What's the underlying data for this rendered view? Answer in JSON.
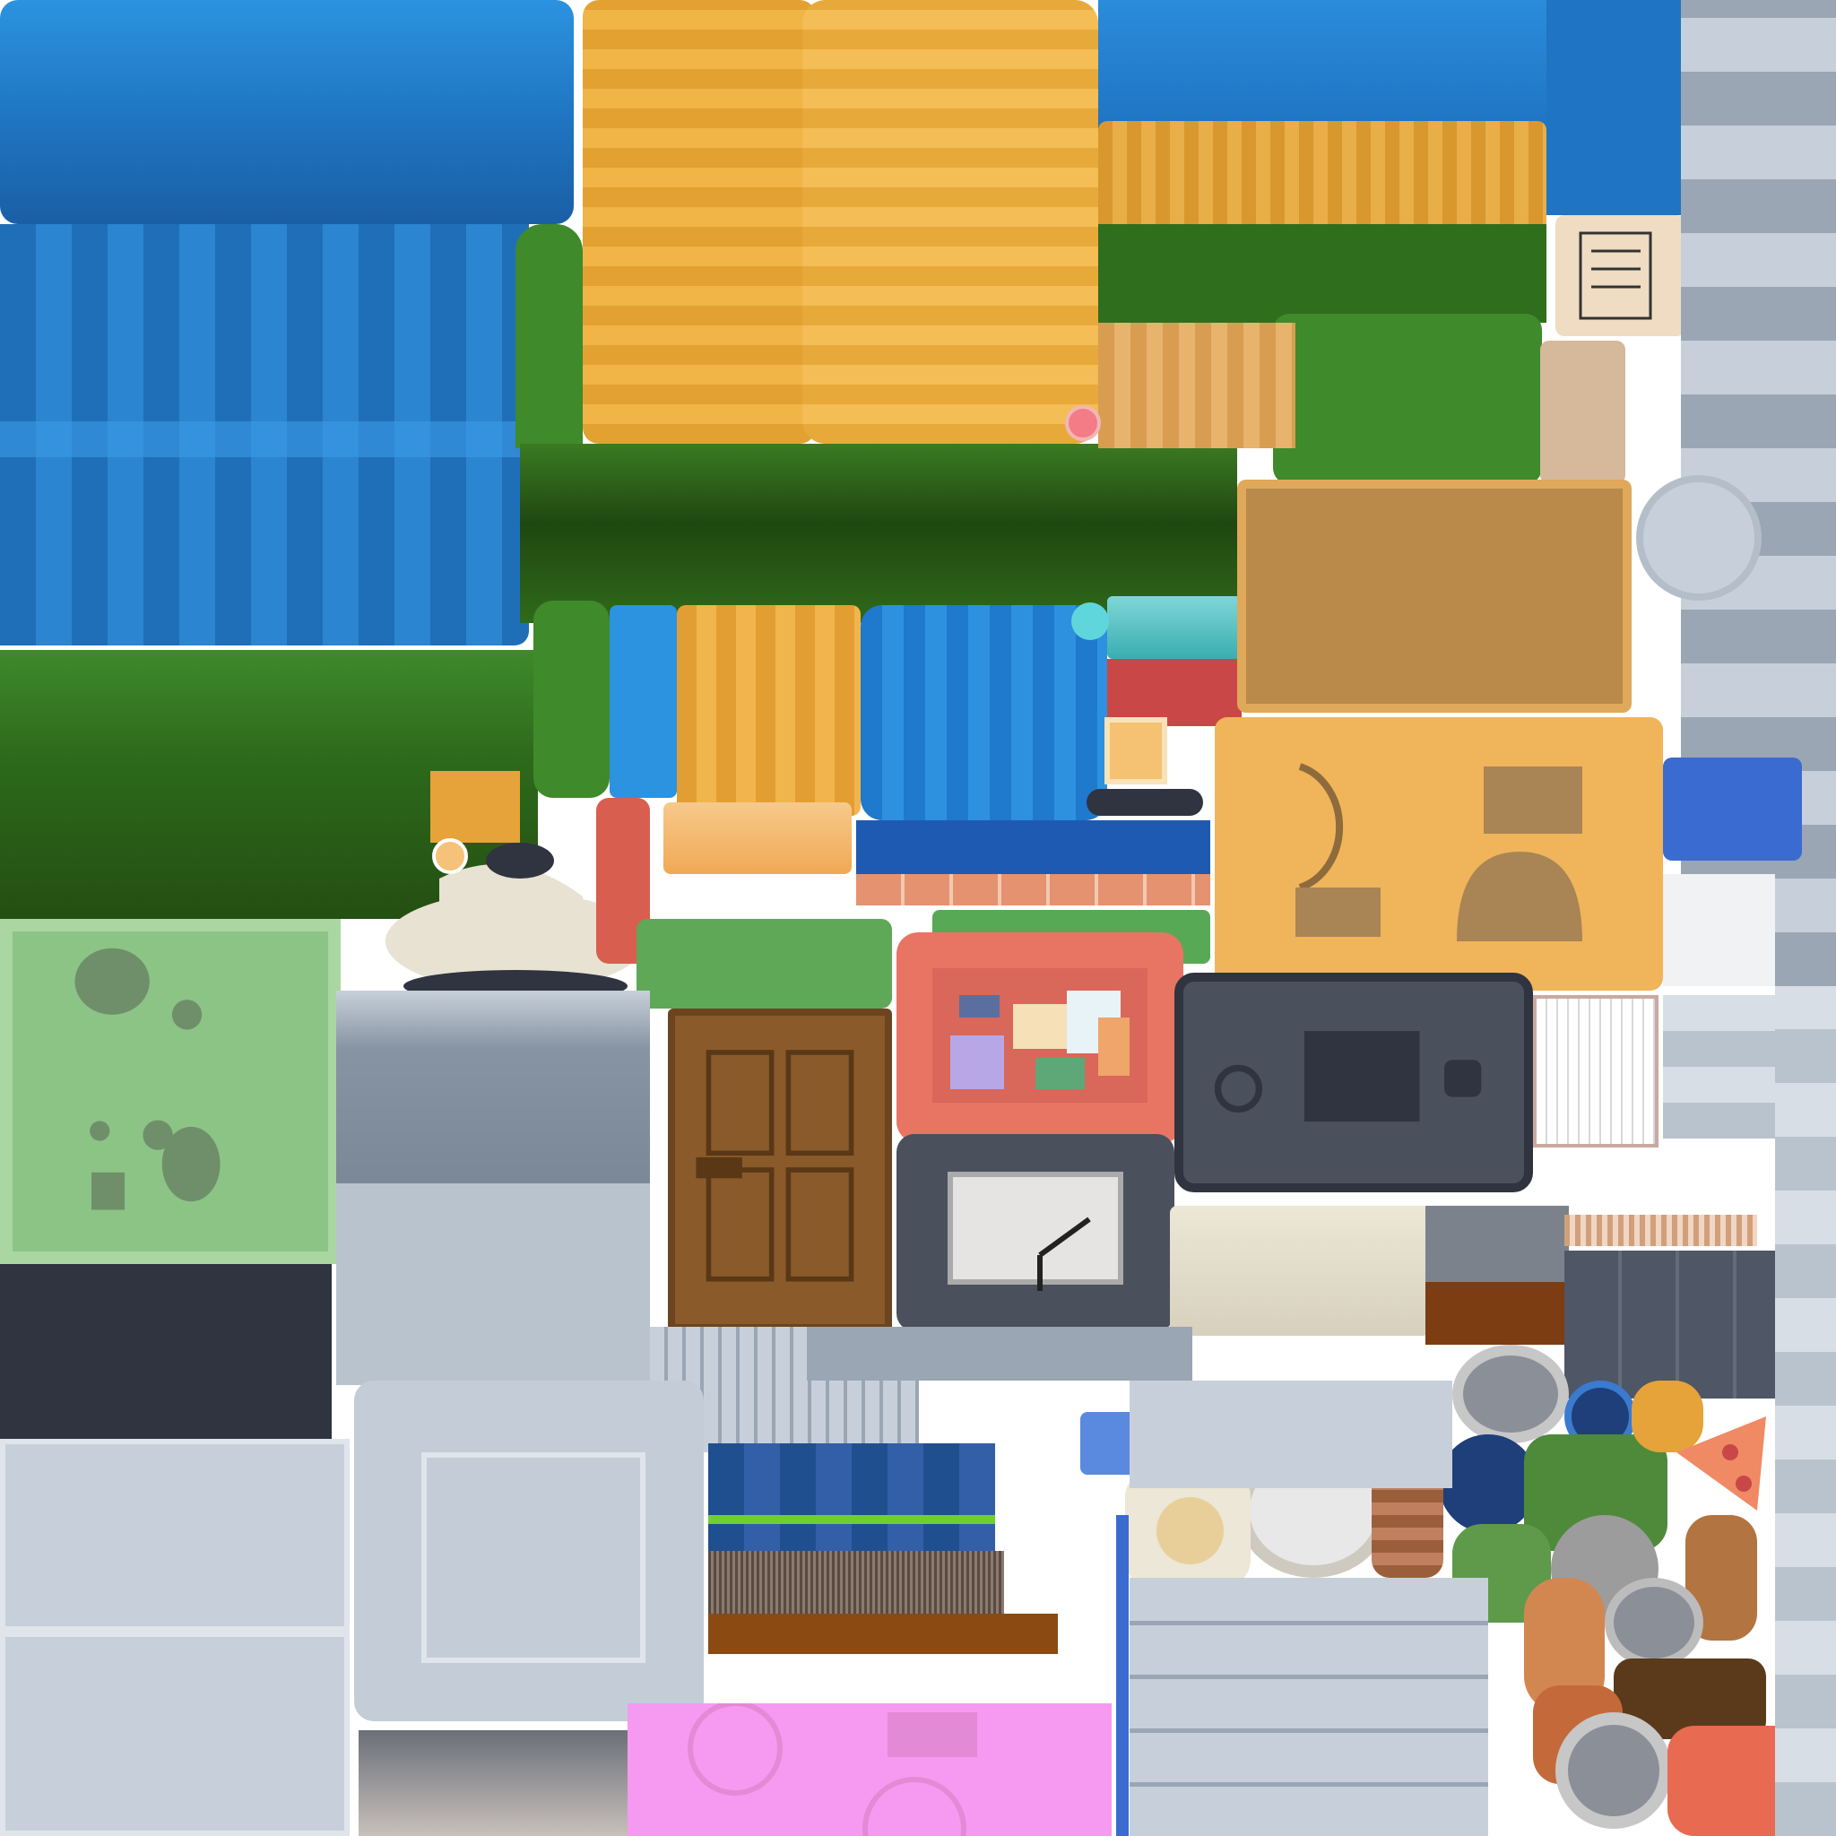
{
  "texture": {
    "kind": "game texture atlas",
    "text_visible": false
  },
  "palette": {
    "water_blue": "#2b8ad6",
    "water_deep": "#1f6fb8",
    "hay_orange": "#e9a73a",
    "grass_green": "#3f7f24",
    "grass_dark": "#244f12",
    "wood_brown": "#8a5a2b",
    "crate_tan": "#e7b060",
    "crate_dark": "#b98a4a",
    "slate_gray": "#9aa6b4",
    "light_gray": "#c7d0da",
    "charcoal": "#2f3440",
    "pale_green": "#8cc486",
    "coral": "#e87464",
    "pink": "#f59af0",
    "cream": "#ece7d6"
  },
  "icons": [
    "door-icon",
    "clock-icon",
    "notice-board-icon",
    "tablet-icon",
    "kettle-icon",
    "paper-note-icon",
    "pizza-slice-icon",
    "stone-wall-pattern"
  ]
}
